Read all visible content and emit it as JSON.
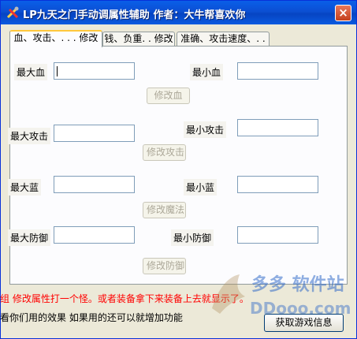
{
  "window": {
    "title": "LP九天之门手动调属性辅助    作者：大牛帮喜欢你",
    "close_glyph": "×"
  },
  "tabs": [
    {
      "label": "血、攻击、. . . 修改"
    },
    {
      "label": "钱、负重. . 修改"
    },
    {
      "label": "准确、攻击速度、. ."
    }
  ],
  "panel": {
    "rows": [
      {
        "max_label": "最大血",
        "min_label": "最小血",
        "button": "修改血"
      },
      {
        "max_label": "最大攻击",
        "min_label": "最小攻击",
        "button": "修改攻击"
      },
      {
        "max_label": "最大蓝",
        "min_label": "最小蓝",
        "button": "修改魔法"
      },
      {
        "max_label": "最大防御",
        "min_label": "最小防御",
        "button": "修改防御"
      }
    ]
  },
  "footer": {
    "line1": "组 修改属性打一个怪。或者装备拿下来装备上去就显示了。",
    "line2": "看你们用的效果 如果用的还可以就增加功能",
    "get_info_button": "获取游戏信息",
    "line1_color": "#ff0000"
  },
  "watermark": {
    "text": "多多 软件站",
    "site": "DDooo.com"
  }
}
